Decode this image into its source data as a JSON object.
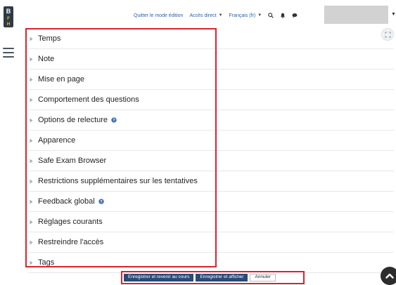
{
  "brand": {
    "logo_letters": [
      "B",
      "F",
      "H"
    ],
    "colors": {
      "dark": "#2e3a48",
      "yellow": "#f2c230"
    }
  },
  "topbar": {
    "edit_mode_label": "Quitter le mode édition",
    "direct_access_label": "Accès direct",
    "language_label": "Français (fr)",
    "icons": [
      "search-icon",
      "notifications-icon",
      "messages-icon"
    ]
  },
  "sections": [
    {
      "label": "Temps",
      "has_help": false
    },
    {
      "label": "Note",
      "has_help": false
    },
    {
      "label": "Mise en page",
      "has_help": false
    },
    {
      "label": "Comportement des questions",
      "has_help": false
    },
    {
      "label": "Options de relecture",
      "has_help": true
    },
    {
      "label": "Apparence",
      "has_help": false
    },
    {
      "label": "Safe Exam Browser",
      "has_help": false
    },
    {
      "label": "Restrictions supplémentaires sur les tentatives",
      "has_help": false
    },
    {
      "label": "Feedback global",
      "has_help": true
    },
    {
      "label": "Réglages courants",
      "has_help": false
    },
    {
      "label": "Restreindre l'accès",
      "has_help": false
    },
    {
      "label": "Tags",
      "has_help": false
    }
  ],
  "footer": {
    "save_return_label": "Enregistrer et revenir au cours",
    "save_display_label": "Enregistrer et afficher",
    "cancel_label": "Annuler"
  },
  "colors": {
    "accent": "#2f5fa5",
    "primary_button": "#2a4a78",
    "highlight": "#d9232f"
  }
}
